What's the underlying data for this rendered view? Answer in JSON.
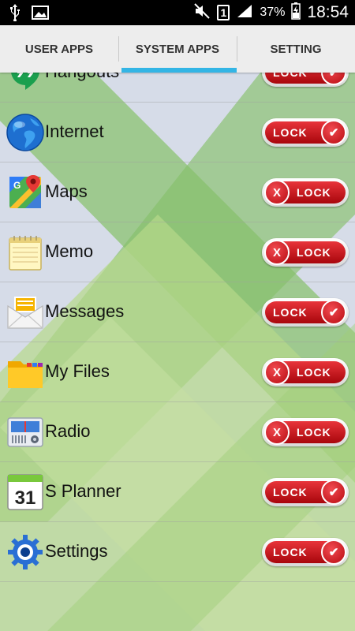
{
  "status_bar": {
    "signal_badge": "1",
    "battery_percent": "37%",
    "time": "18:54"
  },
  "tabs": [
    {
      "label": "USER APPS",
      "active": false
    },
    {
      "label": "SYSTEM APPS",
      "active": true
    },
    {
      "label": "SETTING",
      "active": false
    }
  ],
  "apps": [
    {
      "name": "Hangouts",
      "icon": "hangouts-icon",
      "locked": true,
      "toggle_label": "LOCK"
    },
    {
      "name": "Internet",
      "icon": "globe-icon",
      "locked": true,
      "toggle_label": "LOCK"
    },
    {
      "name": "Maps",
      "icon": "maps-icon",
      "locked": false,
      "toggle_label": "LOCK"
    },
    {
      "name": "Memo",
      "icon": "memo-icon",
      "locked": false,
      "toggle_label": "LOCK"
    },
    {
      "name": "Messages",
      "icon": "envelope-icon",
      "locked": true,
      "toggle_label": "LOCK"
    },
    {
      "name": "My Files",
      "icon": "folder-icon",
      "locked": false,
      "toggle_label": "LOCK"
    },
    {
      "name": "Radio",
      "icon": "radio-icon",
      "locked": false,
      "toggle_label": "LOCK"
    },
    {
      "name": "S Planner",
      "icon": "calendar-icon",
      "locked": true,
      "toggle_label": "LOCK",
      "icon_text": "31"
    },
    {
      "name": "Settings",
      "icon": "gear-icon",
      "locked": true,
      "toggle_label": "LOCK"
    }
  ],
  "colors": {
    "tab_indicator": "#33b5e5",
    "toggle_red": "#d0161c",
    "background_green": "#8fc86a"
  }
}
